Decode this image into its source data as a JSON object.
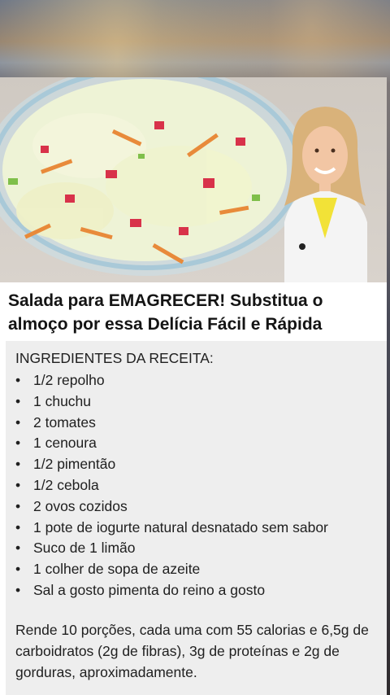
{
  "post": {
    "title": "Salada para EMAGRECER! Substitua o almoço por essa Delícia Fácil e Rápida"
  },
  "description": {
    "section_title": "INGREDIENTES DA RECEITA:",
    "ingredients": [
      "1/2 repolho",
      "1 chuchu",
      "2 tomates",
      "1 cenoura",
      "1/2 pimentão",
      "1/2 cebola",
      "2 ovos cozidos",
      "1 pote de iogurte natural desnatado sem sabor",
      "Suco de 1 limão",
      "1 colher de sopa de azeite",
      "Sal a gosto pimenta do reino a gosto"
    ],
    "summary": "Rende 10 porções, cada uma com 55 calorias e 6,5g de carboidratos (2g de fibras), 3g de proteínas e 2g de gorduras, aproximadamente."
  },
  "colors": {
    "coat": "#f4f4f4",
    "shirt": "#f2e237",
    "hair": "#d9b27a",
    "bowl_rim": "#a9c9d8"
  }
}
